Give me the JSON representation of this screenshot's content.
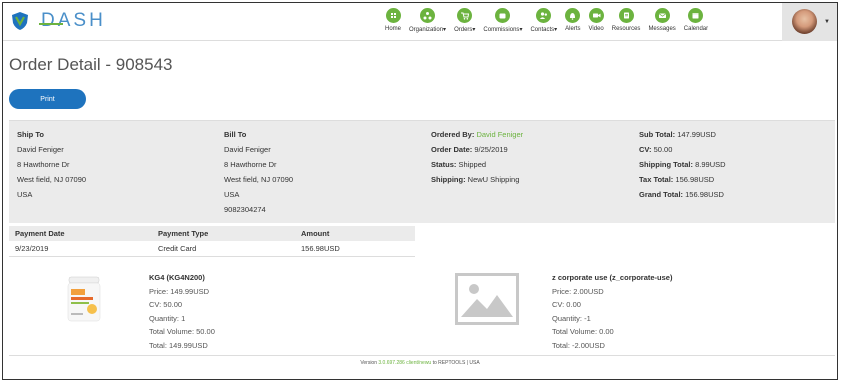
{
  "brand": {
    "name": "DASH",
    "green": "#6cb33f",
    "blue": "#1e73be"
  },
  "nav": [
    {
      "label": "Home",
      "icon": "home-icon"
    },
    {
      "label": "Organization",
      "icon": "organization-icon",
      "caret": "▾"
    },
    {
      "label": "Orders",
      "icon": "orders-icon",
      "caret": "▾"
    },
    {
      "label": "Commissions",
      "icon": "commissions-icon",
      "caret": "▾"
    },
    {
      "label": "Contacts",
      "icon": "contacts-icon",
      "caret": "▾"
    },
    {
      "label": "Alerts",
      "icon": "bell-icon"
    },
    {
      "label": "Video",
      "icon": "video-icon"
    },
    {
      "label": "Resources",
      "icon": "resources-icon"
    },
    {
      "label": "Messages",
      "icon": "envelope-icon"
    },
    {
      "label": "Calendar",
      "icon": "calendar-icon"
    }
  ],
  "page": {
    "title": "Order Detail - 908543",
    "print_label": "Print"
  },
  "ship_to": {
    "heading": "Ship To",
    "lines": [
      "David Feniger",
      "8 Hawthorne Dr",
      "West field, NJ 07090",
      "USA"
    ]
  },
  "bill_to": {
    "heading": "Bill To",
    "lines": [
      "David Feniger",
      "8 Hawthorne Dr",
      "West field, NJ 07090",
      "USA",
      "9082304274"
    ]
  },
  "order_info": {
    "ordered_by_label": "Ordered By:",
    "ordered_by": "David Feniger",
    "order_date_label": "Order Date:",
    "order_date": "9/25/2019",
    "status_label": "Status:",
    "status": "Shipped",
    "shipping_label": "Shipping:",
    "shipping": "NewU Shipping"
  },
  "totals": {
    "sub_total_label": "Sub Total:",
    "sub_total": "147.99USD",
    "cv_label": "CV:",
    "cv": "50.00",
    "shipping_total_label": "Shipping Total:",
    "shipping_total": "8.99USD",
    "tax_total_label": "Tax Total:",
    "tax_total": "156.98USD",
    "grand_total_label": "Grand Total:",
    "grand_total": "156.98USD"
  },
  "payments": {
    "headers": [
      "Payment Date",
      "Payment Type",
      "Amount"
    ],
    "rows": [
      [
        "9/23/2019",
        "Credit Card",
        "156.98USD"
      ]
    ]
  },
  "products": [
    {
      "name": "KG4 (KG4N200)",
      "price": "Price: 149.99USD",
      "cv": "CV: 50.00",
      "quantity": "Quantity: 1",
      "total_volume": "Total Volume: 50.00",
      "total": "Total: 149.99USD"
    },
    {
      "name": "z corporate use (z_corporate-use)",
      "price": "Price: 2.00USD",
      "cv": "CV: 0.00",
      "quantity": "Quantity: -1",
      "total_volume": "Total Volume: 0.00",
      "total": "Total: -2.00USD"
    }
  ],
  "footer": {
    "prefix": "Version ",
    "version": "3.0.697.286 client/newu",
    "suffix": " to REPTOOLS | USA"
  }
}
